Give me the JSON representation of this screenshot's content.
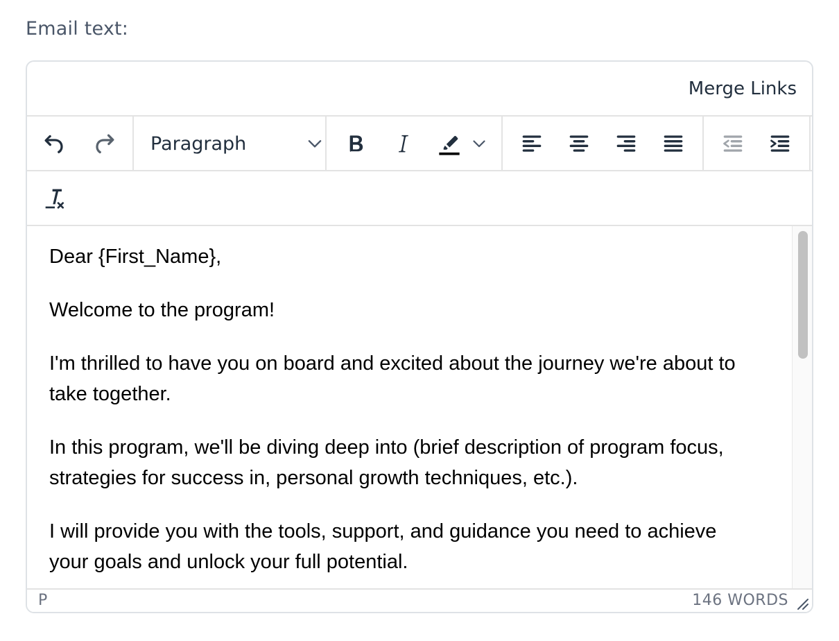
{
  "field": {
    "label": "Email text:"
  },
  "menubar": {
    "merge_links": "Merge Links"
  },
  "toolbar": {
    "block_format": "Paragraph",
    "buttons": [
      {
        "name": "undo",
        "icon": "undo-icon",
        "enabled": true
      },
      {
        "name": "redo",
        "icon": "redo-icon",
        "enabled": true
      },
      {
        "name": "bold",
        "icon": "bold-icon"
      },
      {
        "name": "italic",
        "icon": "italic-icon"
      },
      {
        "name": "highlight-color",
        "icon": "highlighter-icon"
      },
      {
        "name": "align-left",
        "icon": "align-left-icon"
      },
      {
        "name": "align-center",
        "icon": "align-center-icon"
      },
      {
        "name": "align-right",
        "icon": "align-right-icon"
      },
      {
        "name": "justify",
        "icon": "align-justify-icon"
      },
      {
        "name": "outdent",
        "icon": "outdent-icon",
        "enabled": false
      },
      {
        "name": "indent",
        "icon": "indent-icon"
      },
      {
        "name": "clear-formatting",
        "icon": "remove-format-icon"
      }
    ],
    "highlight_color": "#000000"
  },
  "content": {
    "paragraphs": [
      "Dear {First_Name},",
      "Welcome to the program!",
      "I'm thrilled to have you on board and excited about the journey we're about to take together.",
      "In this program, we'll be diving deep into (brief description of program focus, strategies for success in, personal growth techniques, etc.).",
      "I will provide you with the tools, support, and guidance you need to achieve your goals and unlock your full potential."
    ]
  },
  "statusbar": {
    "path": "P",
    "wordcount": "146 WORDS"
  },
  "colors": {
    "border": "#dee2e6",
    "icon": "#222f3e",
    "icon_disabled": "#a0a5ab"
  }
}
